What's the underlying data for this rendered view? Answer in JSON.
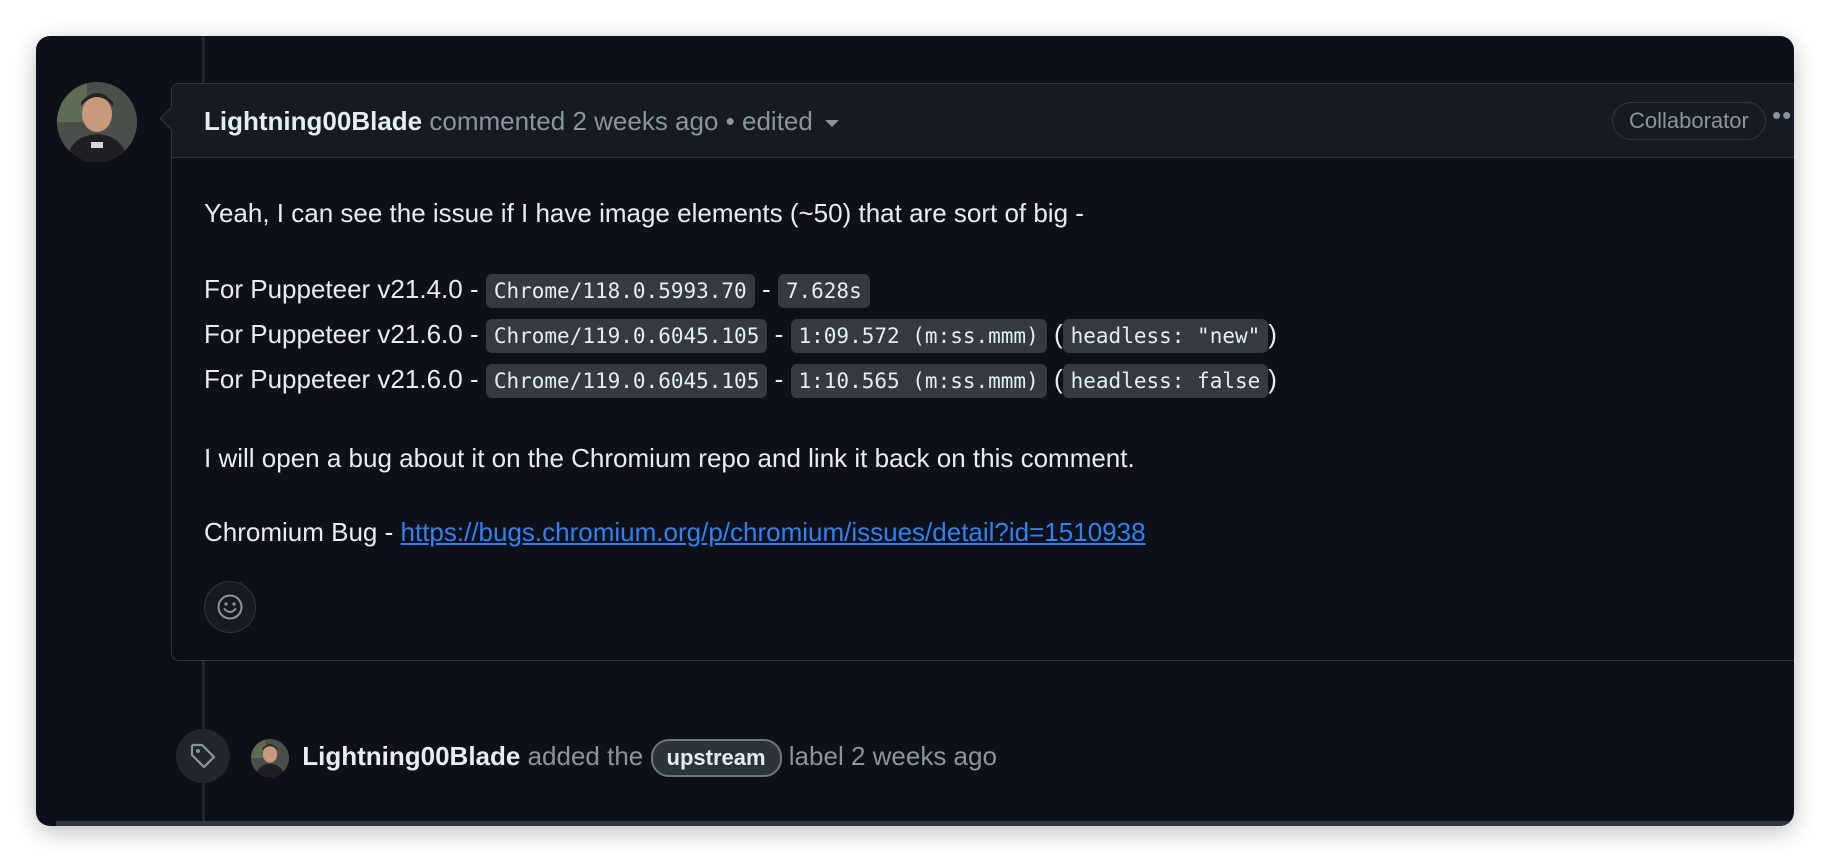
{
  "comment": {
    "author": "Lightning00Blade",
    "action": "commented",
    "time": "2 weeks ago",
    "separator": "•",
    "edited": "edited",
    "badge": "Collaborator",
    "more": "••",
    "body": {
      "intro": "Yeah, I can see the issue if I have image elements (~50) that are sort of big -",
      "runs": [
        {
          "prefix": "For Puppeteer v21.4.0 -",
          "chrome": "Chrome/118.0.5993.70",
          "dash": "-",
          "time": "7.628s"
        },
        {
          "prefix": "For Puppeteer v21.6.0 -",
          "chrome": "Chrome/119.0.6045.105",
          "dash": "-",
          "time": "1:09.572 (m:ss.mmm)",
          "open": "(",
          "mode": "headless: \"new\"",
          "close": ")"
        },
        {
          "prefix": "For Puppeteer v21.6.0 -",
          "chrome": "Chrome/119.0.6045.105",
          "dash": "-",
          "time": "1:10.565 (m:ss.mmm)",
          "open": "(",
          "mode": "headless: false",
          "close": ")"
        }
      ],
      "plan": "I will open a bug about it on the Chromium repo and link it back on this comment.",
      "bug_prefix": "Chromium Bug -",
      "bug_link": "https://bugs.chromium.org/p/chromium/issues/detail?id=1510938"
    },
    "reaction_icon": "smiley-icon"
  },
  "event": {
    "icon": "tag-icon",
    "author": "Lightning00Blade",
    "text_before": "added the",
    "label": "upstream",
    "text_after": "label 2 weeks ago"
  },
  "colors": {
    "background": "#0d1117",
    "header": "#161b22",
    "border": "#30363d",
    "text": "#e6edf3",
    "muted": "#8b949e",
    "link": "#2f81f7",
    "code_bg": "#343942"
  }
}
